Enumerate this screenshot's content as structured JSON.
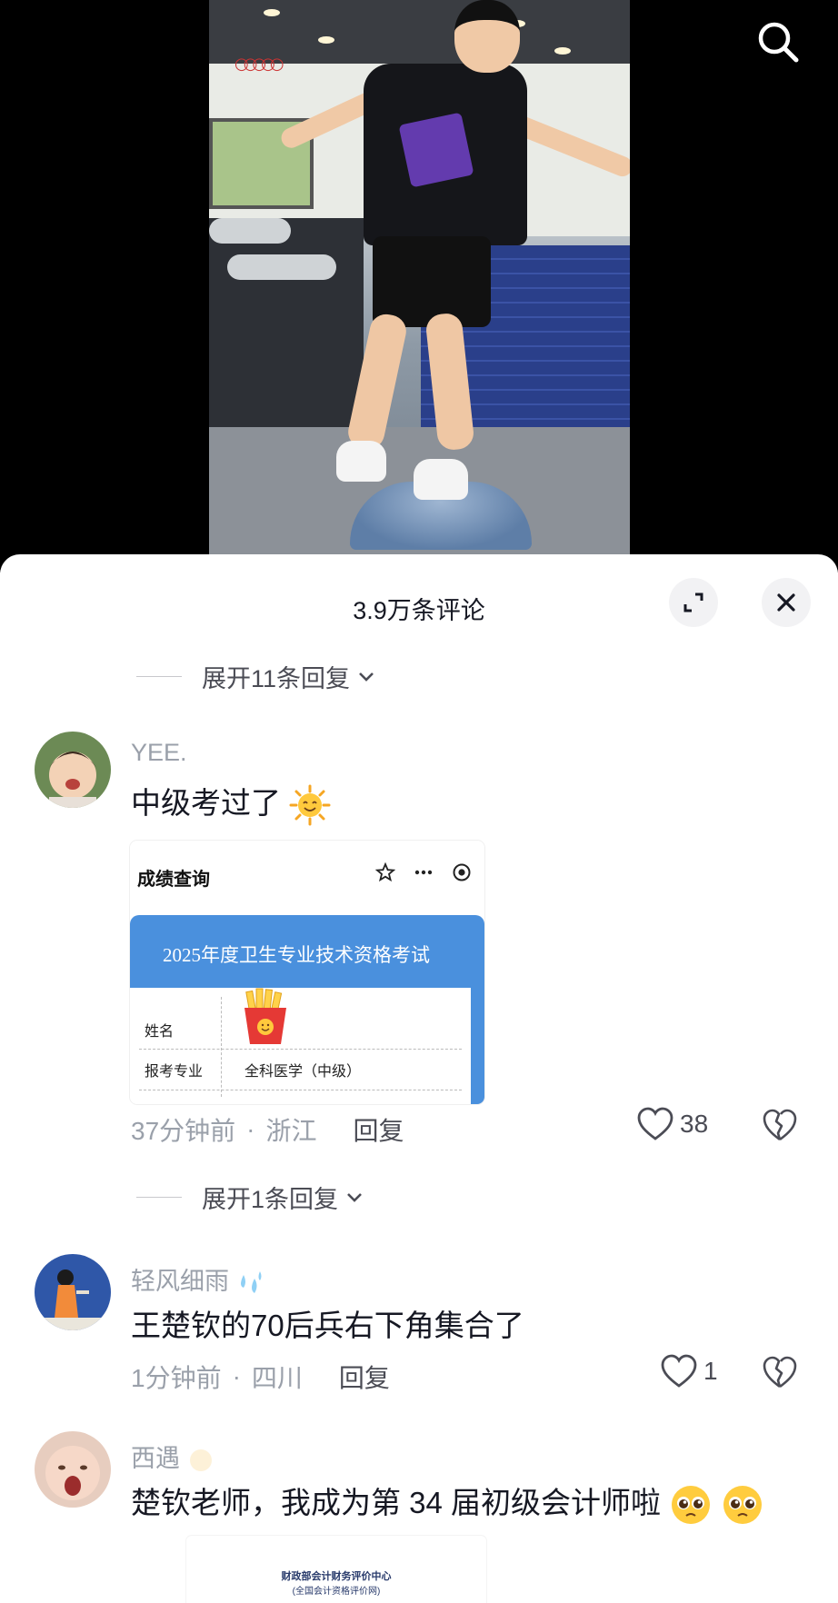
{
  "header": {
    "comment_count_title": "3.9万条评论"
  },
  "replies_toggle_1": "展开11条回复",
  "replies_toggle_2": "展开1条回复",
  "comments": [
    {
      "username": "YEE.",
      "text": "中级考过了",
      "emoji": "sun-face-icon",
      "time": "37分钟前",
      "location": "浙江",
      "reply_label": "回复",
      "likes": "38",
      "attachment": {
        "app_title": "成绩查询",
        "banner": "2025年度卫生专业技术资格考试",
        "name_label": "姓名",
        "major_label": "报考专业",
        "major_value": "全科医学（中级）"
      }
    },
    {
      "username": "轻风细雨",
      "text": "王楚钦的70后兵右下角集合了",
      "time": "1分钟前",
      "location": "四川",
      "reply_label": "回复",
      "likes": "1"
    },
    {
      "username": "西遇",
      "text": "楚钦老师，我成为第 34 届初级会计师啦",
      "emoji": "pleading-face-icon",
      "attachment": {
        "line1": "财政部会计财务评价中心",
        "line2": "(全国会计资格评价网)"
      }
    }
  ],
  "colors": {
    "banner_blue": "#4a90dd",
    "muted_text": "#9aa0aa",
    "primary_text": "#161823"
  }
}
